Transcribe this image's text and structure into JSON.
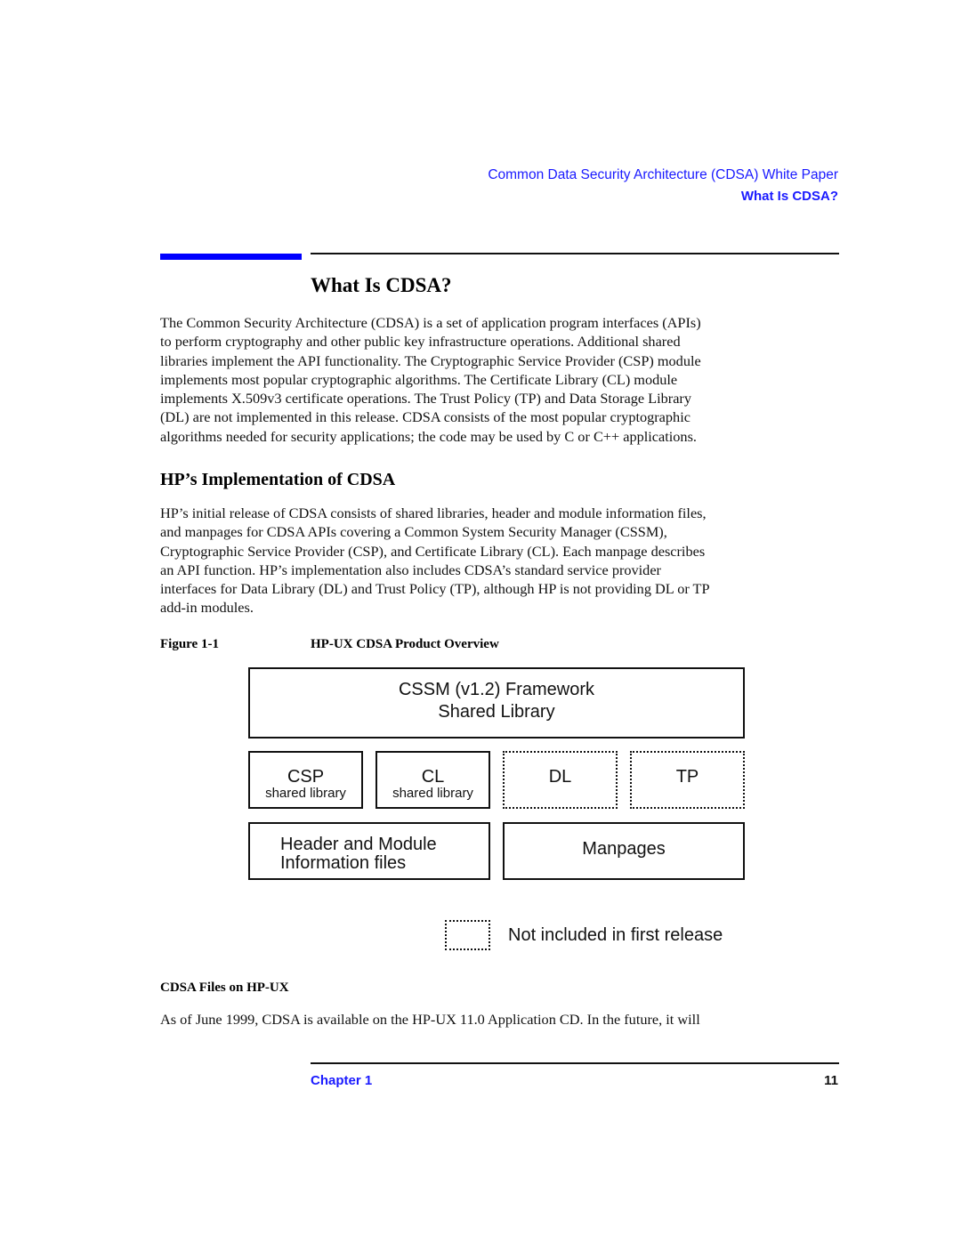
{
  "header": {
    "document_title": "Common Data Security Architecture (CDSA) White Paper",
    "section_title": "What Is CDSA?"
  },
  "colors": {
    "accent_blue": "#0000ff",
    "link_blue": "#1a1aff",
    "text": "#111111"
  },
  "page_title": "What Is CDSA?",
  "intro": {
    "lines": [
      "The Common Security Architecture (CDSA) is a set of application program interfaces (APIs)",
      "to perform cryptography and other public key infrastructure operations.  Additional shared",
      "libraries implement the API functionality. The Cryptographic Service Provider (CSP) module",
      "implements most popular cryptographic algorithms. The Certificate Library (CL) module",
      "implements X.509v3 certificate operations. The Trust Policy (TP) and Data Storage Library",
      "(DL) are not implemented in this release. CDSA consists of the most popular cryptographic",
      "algorithms needed for security applications; the code may be used by C or C++ applications."
    ]
  },
  "implementation": {
    "heading": "HP’s Implementation of CDSA",
    "lines": [
      "HP’s initial release of CDSA consists of shared libraries, header and module information files,",
      "and manpages for CDSA APIs covering a Common System Security Manager (CSSM),",
      "Cryptographic Service Provider (CSP), and Certificate Library (CL).  Each manpage describes",
      "an API function. HP’s implementation also includes CDSA’s standard service provider",
      "interfaces for Data Library (DL) and Trust Policy (TP), although HP is not providing DL or TP",
      "add-in modules."
    ]
  },
  "figure": {
    "label": "Figure 1-1",
    "title": "HP-UX CDSA Product Overview",
    "framework": {
      "line1": "CSSM (v1.2) Framework",
      "line2": "Shared Library"
    },
    "modules": [
      {
        "name": "CSP",
        "sub": "shared library",
        "included": true
      },
      {
        "name": "CL",
        "sub": "shared library",
        "included": true
      },
      {
        "name": "DL",
        "sub": "",
        "included": false
      },
      {
        "name": "TP",
        "sub": "",
        "included": false
      }
    ],
    "header_files": {
      "line1": "Header and Module",
      "line2": "Information files"
    },
    "manpages": "Manpages",
    "legend": {
      "style": "dotted-border",
      "text": "Not included in first release"
    }
  },
  "files_section": {
    "heading": "CDSA Files on HP-UX",
    "lines": [
      "As of June 1999, CDSA is available on the HP-UX 11.0 Application CD.  In the future, it will"
    ]
  },
  "footer": {
    "chapter": "Chapter 1",
    "page_number": "11"
  }
}
